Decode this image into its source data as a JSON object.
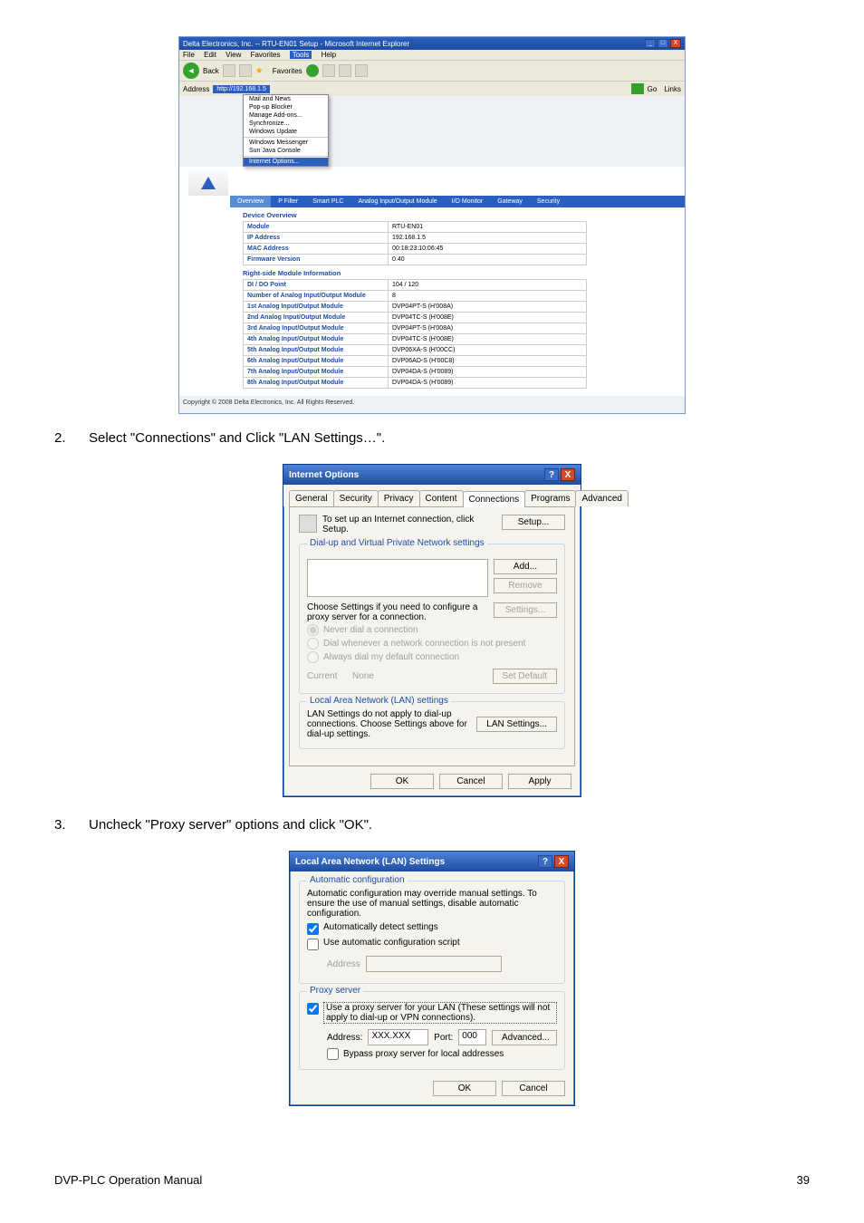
{
  "instructions": {
    "step2": "Select \"Connections\" and Click \"LAN Settings…\".",
    "step3": "Uncheck \"Proxy server\" options and click \"OK\"."
  },
  "browser": {
    "title": "Delta Electronics, Inc. -- RTU-EN01 Setup - Microsoft Internet Explorer",
    "menus": [
      "File",
      "Edit",
      "View",
      "Favorites",
      "Tools",
      "Help"
    ],
    "toolbar": {
      "back": "Back",
      "favorites": "Favorites"
    },
    "addressLabel": "Address",
    "addressValue": "http://192.168.1.5",
    "go": "Go",
    "links": "Links",
    "dropdown": [
      "Mail and News",
      "Pop-up Blocker",
      "Manage Add-ons...",
      "Synchronize...",
      "Windows Update",
      "",
      "Windows Messenger",
      "Sun Java Console",
      "",
      "Internet Options..."
    ],
    "nav": [
      "Overview",
      "P Filter",
      "Smart PLC",
      "Analog Input/Output Module",
      "I/O Monitor",
      "Gateway",
      "Security"
    ],
    "deviceHeader": "Device Overview",
    "device": [
      [
        "Module",
        "RTU-EN01"
      ],
      [
        "IP Address",
        "192.168.1.5"
      ],
      [
        "MAC Address",
        "00:18:23:10:06:45"
      ],
      [
        "Firmware Version",
        "0.40"
      ]
    ],
    "rsHeader": "Right-side Module Information",
    "rs": [
      [
        "DI / DO Point",
        "104 / 120"
      ],
      [
        "Number of Analog Input/Output Module",
        "8"
      ],
      [
        "1st Analog Input/Output Module",
        "DVP04PT-S (H'008A)"
      ],
      [
        "2nd Analog Input/Output Module",
        "DVP04TC-S (H'008E)"
      ],
      [
        "3rd Analog Input/Output Module",
        "DVP04PT-S (H'008A)"
      ],
      [
        "4th Analog Input/Output Module",
        "DVP04TC-S (H'008E)"
      ],
      [
        "5th Analog Input/Output Module",
        "DVP06XA-S (H'00CC)"
      ],
      [
        "6th Analog Input/Output Module",
        "DVP06AD-S (H'00C8)"
      ],
      [
        "7th Analog Input/Output Module",
        "DVP04DA-S (H'0089)"
      ],
      [
        "8th Analog Input/Output Module",
        "DVP04DA-S (H'0089)"
      ]
    ],
    "copyright": "Copyright © 2008 Delta Electronics, Inc. All Rights Reserved."
  },
  "iopt": {
    "title": "Internet Options",
    "tabs": [
      "General",
      "Security",
      "Privacy",
      "Content",
      "Connections",
      "Programs",
      "Advanced"
    ],
    "setupText": "To set up an Internet connection, click Setup.",
    "setupBtn": "Setup...",
    "dialupTitle": "Dial-up and Virtual Private Network settings",
    "addBtn": "Add...",
    "removeBtn": "Remove",
    "chooseText": "Choose Settings if you need to configure a proxy server for a connection.",
    "settingsBtn": "Settings...",
    "r1": "Never dial a connection",
    "r2": "Dial whenever a network connection is not present",
    "r3": "Always dial my default connection",
    "currentLabel": "Current",
    "currentValue": "None",
    "setDefault": "Set Default",
    "lanTitle": "Local Area Network (LAN) settings",
    "lanText": "LAN Settings do not apply to dial-up connections. Choose Settings above for dial-up settings.",
    "lanBtn": "LAN Settings...",
    "ok": "OK",
    "cancel": "Cancel",
    "apply": "Apply"
  },
  "lan": {
    "title": "Local Area Network (LAN) Settings",
    "autoTitle": "Automatic configuration",
    "autoText": "Automatic configuration may override manual settings. To ensure the use of manual settings, disable automatic configuration.",
    "c1": "Automatically detect settings",
    "c2": "Use automatic configuration script",
    "addrLabel": "Address",
    "proxyTitle": "Proxy server",
    "proxyChk": "Use a proxy server for your LAN (These settings will not apply to dial-up or VPN connections).",
    "addrLabel2": "Address:",
    "addrVal": "XXX.XXX",
    "portLabel": "Port:",
    "portVal": "000",
    "advBtn": "Advanced...",
    "bypass": "Bypass proxy server for local addresses",
    "ok": "OK",
    "cancel": "Cancel"
  },
  "footer": {
    "left": "DVP-PLC Operation Manual",
    "right": "39"
  }
}
